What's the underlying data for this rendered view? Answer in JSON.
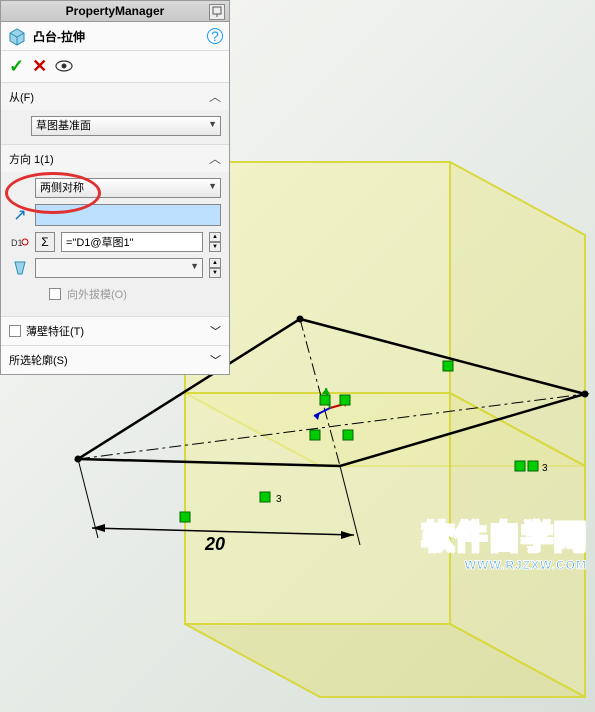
{
  "header": {
    "title": "PropertyManager"
  },
  "feature": {
    "name": "凸台-拉伸"
  },
  "sections": {
    "from": {
      "label": "从(F)",
      "option": "草图基准面"
    },
    "direction1": {
      "label": "方向 1(1)",
      "option": "两侧对称",
      "formula": "=\"D1@草图1\"",
      "draft_label": "向外拔模(O)"
    },
    "thin": {
      "label": "薄壁特征(T)"
    },
    "contour": {
      "label": "所选轮廓(S)"
    }
  },
  "dimension": {
    "value": "20"
  },
  "watermark": {
    "main": "软件自学网",
    "sub": "WWW.RJZXW.COM"
  },
  "icons": {
    "pin": "pin-icon",
    "help": "?",
    "ok": "✓",
    "cancel": "✕",
    "eye": "eye-icon",
    "reverse": "↗",
    "link": "link-icon",
    "sigma": "Σ",
    "draft": "draft-icon"
  }
}
